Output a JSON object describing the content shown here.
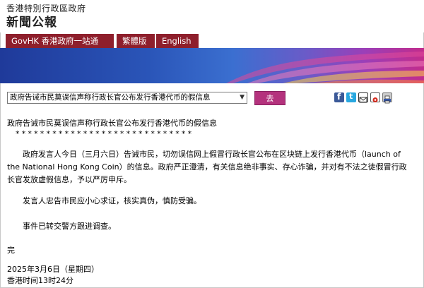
{
  "header": {
    "gov_name": "香港特別行政區政府",
    "site_title": "新聞公報"
  },
  "nav": {
    "govhk": "GovHK 香港政府一站通",
    "traditional": "繁體版",
    "english": "English"
  },
  "toolbar": {
    "select_value": "政府告诫市民莫误信声称行政长官公布发行香港代币的假信息",
    "go_label": "去"
  },
  "share": {
    "icons": [
      "facebook-icon",
      "twitter-icon",
      "email-icon",
      "weibo-icon",
      "print-icon"
    ]
  },
  "article": {
    "headline": "政府告诫市民莫误信声称行政长官公布发行香港代币的假信息",
    "stars": "*****************************",
    "para1_line1": "　　政府发言人今日（三月六日）告诫市民，切勿误信网上假冒行政长官公布在区块链上发行香港代币（launch of",
    "para1_line2": "the National Hong Kong Coin）的信息。政府严正澄清，有关信息绝非事实、存心诈骗，并对有不法之徒假冒行政",
    "para1_line3": "长官发放虚假信息，予以严厉申斥。",
    "para2": "　　发言人忠告市民应小心求证，核实真伪，慎防受骗。",
    "para3": "　　事件已转交警方跟进调查。",
    "end_mark": "完",
    "date": "2025年3月6日（星期四）",
    "time": "香港时间13时24分"
  },
  "colors": {
    "nav_bg": "#8e1f2c",
    "go_button": "#b4327d",
    "banner_start": "#1f3a9a",
    "banner_end": "#c22c8c"
  }
}
